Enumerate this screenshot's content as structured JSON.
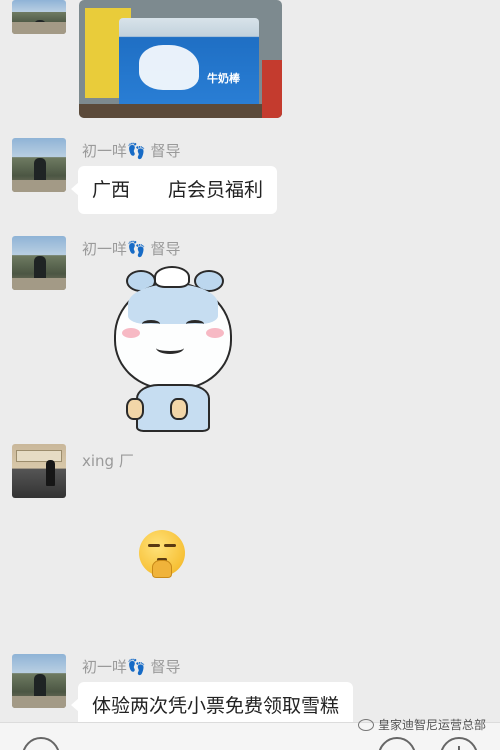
{
  "messages": [
    {
      "type": "image",
      "description": "photo"
    },
    {
      "type": "text",
      "sender": "初一咩👣 督导",
      "text": "广西　　店会员福利"
    },
    {
      "type": "sticker",
      "sender": "初一咩👣 督导"
    },
    {
      "type": "emoji",
      "sender": "xing 厂"
    },
    {
      "type": "text",
      "sender": "初一咩👣 督导",
      "text": "体验两次凭小票免费领取雪糕"
    }
  ],
  "photo": {
    "brand_text": "牛奶棒"
  },
  "watermark": "皇家迪智尼运营总部",
  "colors": {
    "background": "#ececec",
    "bubble": "#ffffff",
    "sender": "#9a9a9a"
  }
}
